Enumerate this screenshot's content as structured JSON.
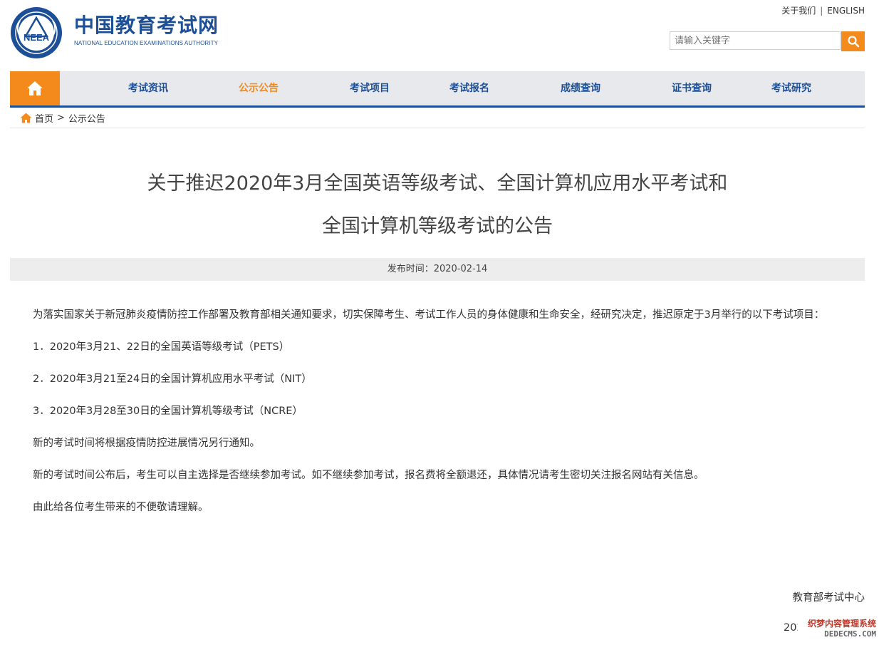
{
  "header": {
    "logo_cn": "中国教育考试网",
    "logo_en": "NATIONAL EDUCATION EXAMINATIONS AUTHORITY",
    "logo_emblem_text": "NEEA",
    "top_links": [
      "关于我们",
      "ENGLISH"
    ],
    "search_placeholder": "请输入关键字"
  },
  "nav": {
    "items": [
      {
        "label": "考试资讯"
      },
      {
        "label": "公示公告",
        "active": true
      },
      {
        "label": "考试项目"
      },
      {
        "label": "考试报名"
      },
      {
        "label": "成绩查询"
      },
      {
        "label": "证书查询"
      },
      {
        "label": "考试研究"
      }
    ]
  },
  "breadcrumb": {
    "home": "首页",
    "separator": ">",
    "current": "公示公告"
  },
  "article": {
    "title_line1": "关于推迟2020年3月全国英语等级考试、全国计算机应用水平考试和",
    "title_line2": "全国计算机等级考试的公告",
    "publish": "发布时间：2020-02-14",
    "paragraphs": [
      "为落实国家关于新冠肺炎疫情防控工作部署及教育部相关通知要求，切实保障考生、考试工作人员的身体健康和生命安全，经研究决定，推迟原定于3月举行的以下考试项目：",
      "1．2020年3月21、22日的全国英语等级考试（PETS）",
      "2．2020年3月21至24日的全国计算机应用水平考试（NIT）",
      "3．2020年3月28至30日的全国计算机等级考试（NCRE）",
      "新的考试时间将根据疫情防控进展情况另行通知。",
      "新的考试时间公布后，考生可以自主选择是否继续参加考试。如不继续参加考试，报名费将全额退还，具体情况请考生密切关注报名网站有关信息。",
      "由此给各位考生带来的不便敬请理解。"
    ],
    "signature": "教育部考试中心",
    "date_partial": "202"
  },
  "watermark": {
    "line1": "织梦内容管理系统",
    "line2": "DEDECMS.COM"
  },
  "colors": {
    "brand_blue": "#1d4f96",
    "accent_orange": "#f48a1c",
    "nav_bg": "#e7e9ec"
  },
  "icons": {
    "home": "home-icon",
    "search": "search-icon"
  }
}
